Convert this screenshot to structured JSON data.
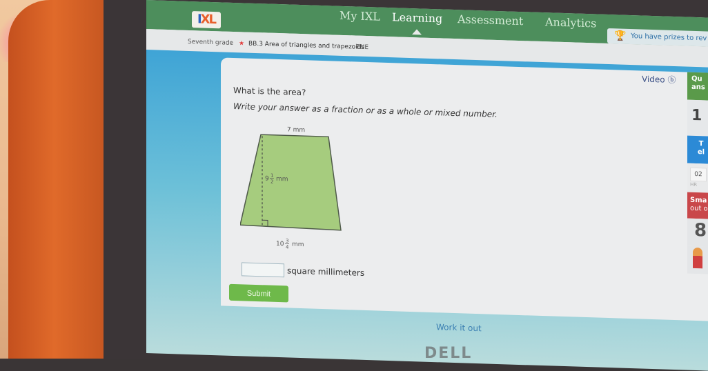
{
  "nav": {
    "logo": "IXL",
    "links": [
      "My IXL",
      "Learning",
      "Assessment",
      "Analytics"
    ],
    "active": "Learning"
  },
  "breadcrumb": {
    "grade": "Seventh grade",
    "separator": "›",
    "skill": "BB.3 Area of triangles and trapezoids",
    "code": "ENE"
  },
  "prizes": {
    "text": "You have prizes to rev"
  },
  "question": {
    "prompt": "What is the area?",
    "instruction": "Write your answer as a fraction or as a whole or mixed number.",
    "figure": {
      "shape": "trapezoid",
      "top_base": "7 mm",
      "height_whole": "9",
      "height_num": "1",
      "height_den": "2",
      "height_unit": "mm",
      "bottom_whole": "10",
      "bottom_num": "3",
      "bottom_den": "4",
      "bottom_unit": "mm",
      "fill": "#a6cc7e"
    },
    "answer_value": "",
    "unit": "square millimeters",
    "submit": "Submit"
  },
  "video": {
    "label": "Video",
    "icon": "play-circle-icon"
  },
  "sidebar": {
    "questions_label_1": "Qu",
    "questions_label_2": "ans",
    "questions_count": "1",
    "time_label_1": "T",
    "time_label_2": "el",
    "time_hr": "02",
    "time_hr_label": "HR",
    "smartscore_1": "Sma",
    "smartscore_2": "out o",
    "smartscore_value": "8"
  },
  "footer": {
    "work_it_out": "Work it out",
    "brand": "DELL"
  }
}
